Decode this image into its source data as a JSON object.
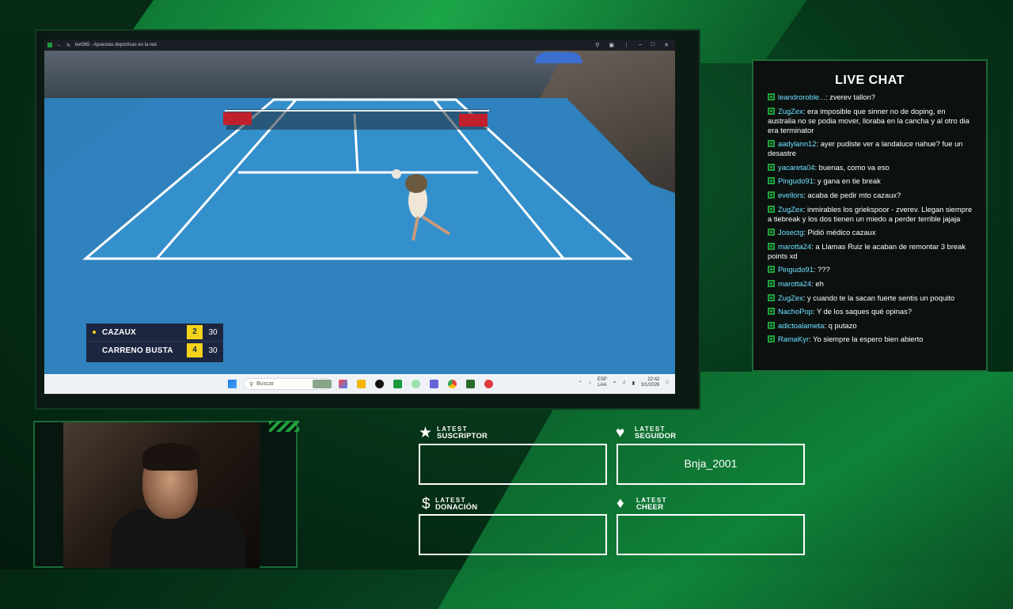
{
  "browser": {
    "title": "bet365 - Apuestas deportivas en la red"
  },
  "scoreboard": {
    "rows": [
      {
        "player": "CAZAUX",
        "sets": "2",
        "points": "30"
      },
      {
        "player": "CARRENO BUSTA",
        "sets": "4",
        "points": "30"
      }
    ]
  },
  "taskbar": {
    "search_placeholder": "Buscar",
    "lang_top": "ESP",
    "lang_bottom": "LAA",
    "time": "22:42",
    "date": "3/1/2026"
  },
  "chat": {
    "title": "LIVE CHAT",
    "messages": [
      {
        "user": "leandroroble...",
        "text": ": zverev tallon?"
      },
      {
        "user": "ZugZex",
        "text": ": era imposible que sinner no de doping, en australia no se podia mover, lloraba en la cancha y al otro dia era terminator"
      },
      {
        "user": "aadylann12",
        "text": ": ayer pudiste ver a landaluce nahue? fue un desastre"
      },
      {
        "user": "yacareta04",
        "text": ": buenas, como va eso"
      },
      {
        "user": "Pingudo91",
        "text": ": y gana en tie break"
      },
      {
        "user": "evellors",
        "text": ": acaba de pedir mto cazaux?"
      },
      {
        "user": "ZugZex",
        "text": ": inmirables los griekspoor - zverev. Llegan siempre a tiebreak y los dos tienen un miedo a perder terrible jajaja"
      },
      {
        "user": "Josectg",
        "text": ": Pidió médico cazaux"
      },
      {
        "user": "marotta24",
        "text": ": a Llamas Ruiz le acaban de remontar 3 break points xd"
      },
      {
        "user": "Pingudo91",
        "text": ": ???"
      },
      {
        "user": "marotta24",
        "text": ": eh"
      },
      {
        "user": "ZugZex",
        "text": ": y cuando te la sacan fuerte sentis un poquito"
      },
      {
        "user": "NachoPop",
        "text": ": Y de los saques qué opinas?"
      },
      {
        "user": "adictoalameta",
        "text": ": q putazo"
      },
      {
        "user": "RamaKyr",
        "text": ": Yo siempre la espero bien abierto"
      }
    ]
  },
  "widgets": {
    "subscriber": {
      "top": "LATEST",
      "bottom": "SUSCRIPTOR",
      "value": "",
      "icon": "star-icon"
    },
    "follower": {
      "top": "LATEST",
      "bottom": "SEGUIDOR",
      "value": "Bnja_2001",
      "icon": "heart-icon"
    },
    "donation": {
      "top": "LATEST",
      "bottom": "DONACIÓN",
      "value": "",
      "icon": "dollar-icon"
    },
    "cheer": {
      "top": "LATEST",
      "bottom": "CHEER",
      "value": "",
      "icon": "diamond-icon"
    }
  },
  "colors": {
    "accent": "#1fa33c",
    "chat_user": "#6ee0ff",
    "score_highlight": "#f2d21b"
  }
}
